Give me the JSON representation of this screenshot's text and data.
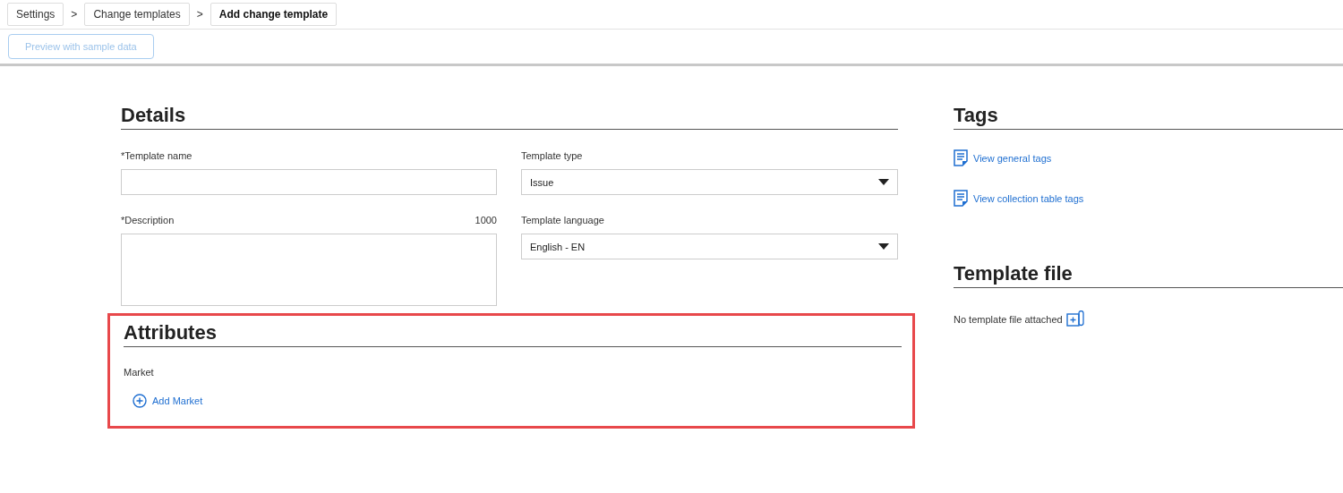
{
  "breadcrumbs": [
    {
      "label": "Settings",
      "selected": false
    },
    {
      "label": "Change templates",
      "selected": false
    },
    {
      "label": "Add change template",
      "selected": true
    }
  ],
  "breadcrumb_separator": ">",
  "toolbar": {
    "preview_button": {
      "label": "Preview with sample data",
      "disabled": true
    }
  },
  "details": {
    "title": "Details",
    "template_name": {
      "label": "*Template name"
    },
    "template_type": {
      "label": "Template type",
      "value": "Issue"
    },
    "description": {
      "label": "*Description",
      "counter": "1000"
    },
    "template_language": {
      "label": "Template language",
      "value": "English - EN"
    }
  },
  "attributes": {
    "title": "Attributes",
    "highlighted": true,
    "field_label": "Market",
    "add_link": "Add Market"
  },
  "tags": {
    "title": "Tags",
    "links": [
      "View general tags",
      "View collection table tags"
    ]
  },
  "template_file": {
    "title": "Template file",
    "status": "No template file attached"
  }
}
